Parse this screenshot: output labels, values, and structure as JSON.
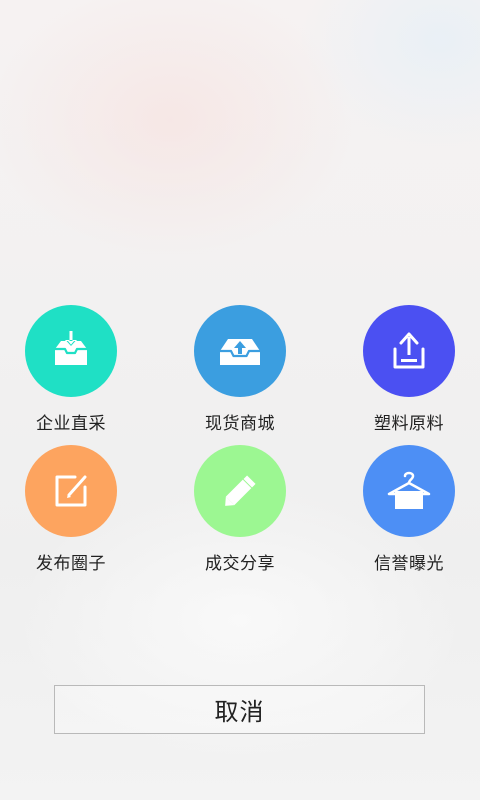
{
  "menu": {
    "items": [
      {
        "label": "企业直采",
        "icon": "tray-download-icon",
        "color": "#1fe0c5"
      },
      {
        "label": "现货商城",
        "icon": "tray-upload-icon",
        "color": "#3b9ee0"
      },
      {
        "label": "塑料原料",
        "icon": "box-upload-icon",
        "color": "#4b50f2"
      },
      {
        "label": "发布圈子",
        "icon": "edit-icon",
        "color": "#fda45f"
      },
      {
        "label": "成交分享",
        "icon": "pencil-icon",
        "color": "#9cf792"
      },
      {
        "label": "信誉曝光",
        "icon": "hanger-icon",
        "color": "#4d8ff5"
      }
    ]
  },
  "cancel_label": "取消"
}
